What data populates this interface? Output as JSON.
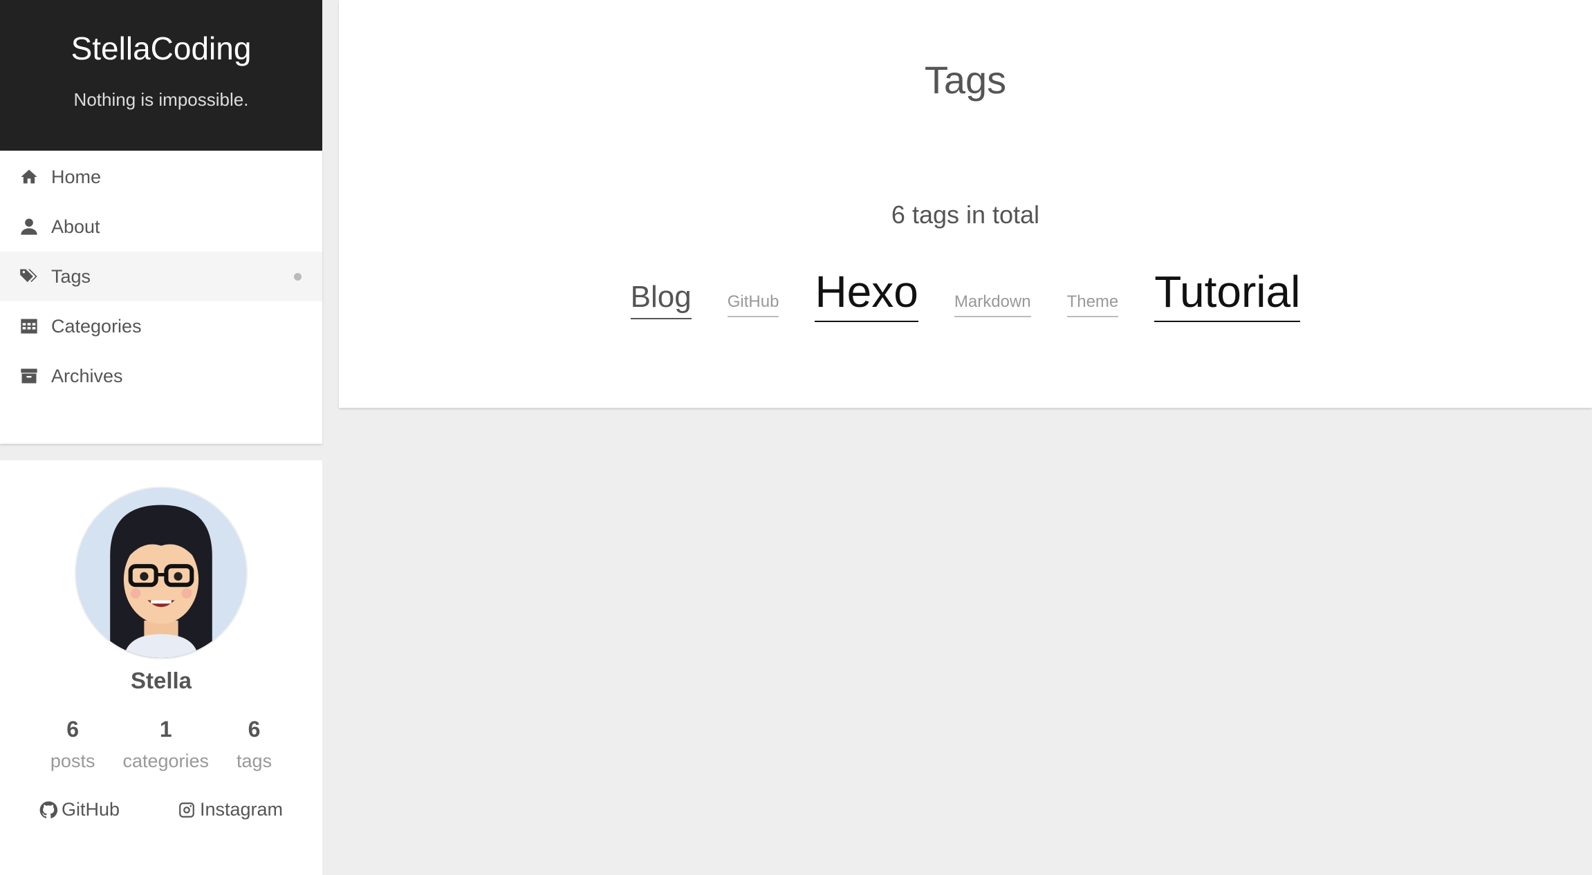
{
  "brand": {
    "title": "StellaCoding",
    "subtitle": "Nothing is impossible."
  },
  "menu": {
    "items": [
      {
        "label": "Home",
        "icon": "home-icon"
      },
      {
        "label": "About",
        "icon": "user-icon"
      },
      {
        "label": "Tags",
        "icon": "tags-icon",
        "active": true
      },
      {
        "label": "Categories",
        "icon": "grid-icon"
      },
      {
        "label": "Archives",
        "icon": "archive-icon"
      }
    ]
  },
  "author": {
    "name": "Stella",
    "avatar_icon": "avatar-image",
    "stats": [
      {
        "count": "6",
        "label": "posts"
      },
      {
        "count": "1",
        "label": "categories"
      },
      {
        "count": "6",
        "label": "tags"
      }
    ],
    "links": [
      {
        "label": "GitHub",
        "icon": "github-icon"
      },
      {
        "label": "Instagram",
        "icon": "instagram-icon"
      }
    ]
  },
  "main": {
    "title": "Tags",
    "tag_count": "6 tags in total",
    "tags": [
      "Blog",
      "GitHub",
      "Hexo",
      "Markdown",
      "Theme",
      "Tutorial"
    ]
  },
  "colors": {
    "header_bg": "#222222",
    "page_bg": "#eeeeee",
    "text": "#555555"
  }
}
